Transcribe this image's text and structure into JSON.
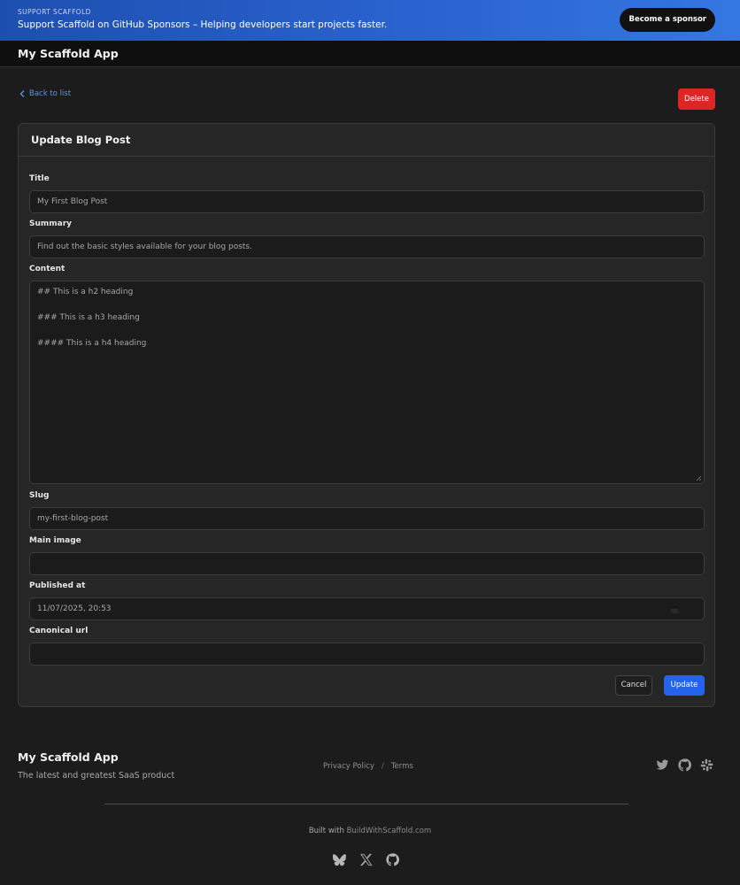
{
  "banner": {
    "eyebrow": "SUPPORT SCAFFOLD",
    "text": "Support Scaffold on GitHub Sponsors – Helping developers start projects faster.",
    "button_label": "Become a sponsor"
  },
  "navbar": {
    "brand": "My Scaffold App"
  },
  "actions": {
    "back_label": "Back to list",
    "delete_label": "Delete"
  },
  "form": {
    "title": "Update Blog Post",
    "fields": {
      "title": {
        "label": "Title",
        "value": "My First Blog Post"
      },
      "summary": {
        "label": "Summary",
        "value": "Find out the basic styles available for your blog posts."
      },
      "content": {
        "label": "Content",
        "lines": [
          "## This is a h2 heading",
          "### This is a h3 heading",
          "#### This is a h4 heading"
        ]
      },
      "slug": {
        "label": "Slug",
        "value": "my-first-blog-post"
      },
      "main_image": {
        "label": "Main image",
        "value": ""
      },
      "published_at": {
        "label": "Published at",
        "value": "11/07/2025, 20:53"
      },
      "canonical_url": {
        "label": "Canonical url",
        "value": ""
      }
    },
    "cancel_label": "Cancel",
    "update_label": "Update"
  },
  "footer": {
    "brand": "My Scaffold App",
    "tagline": "The latest and greatest SaaS product",
    "links": [
      "Privacy Policy",
      "Terms"
    ],
    "separator": "/",
    "social_icons": [
      "twitter-icon",
      "github-icon",
      "slack-icon"
    ],
    "built_with_prefix": "Built with",
    "built_with_link": "BuildWithScaffold.com",
    "bottom_icons": [
      "bluesky-icon",
      "x-icon",
      "github-icon"
    ]
  }
}
